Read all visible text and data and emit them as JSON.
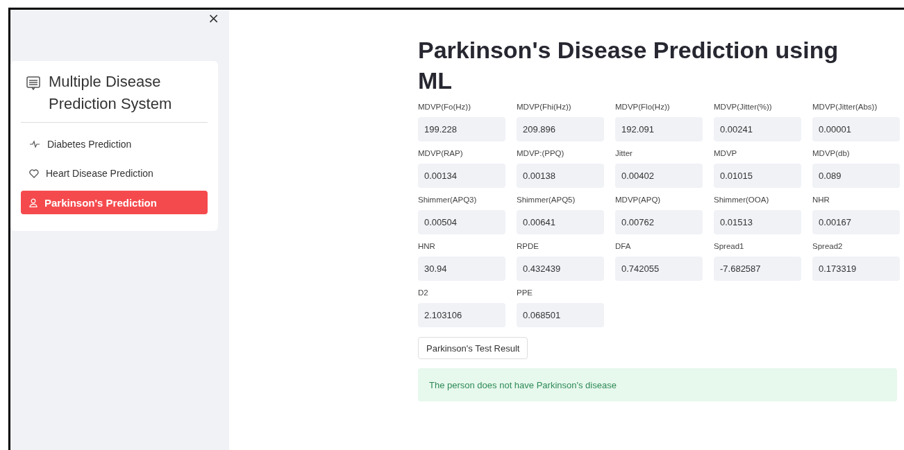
{
  "sidebar": {
    "close": "×",
    "title": "Multiple Disease Prediction System",
    "items": [
      {
        "label": "Diabetes Prediction",
        "kind": "activity",
        "selected": false
      },
      {
        "label": "Heart Disease Prediction",
        "kind": "heart",
        "selected": false
      },
      {
        "label": "Parkinson's Prediction",
        "kind": "person",
        "selected": true
      }
    ]
  },
  "main": {
    "title": "Parkinson's Disease Prediction using ML",
    "fields": [
      {
        "label": "MDVP(Fo(Hz))",
        "value": "199.228"
      },
      {
        "label": "MDVP(Fhi(Hz))",
        "value": "209.896"
      },
      {
        "label": "MDVP(Flo(Hz))",
        "value": "192.091"
      },
      {
        "label": "MDVP(Jitter(%))",
        "value": "0.00241"
      },
      {
        "label": "MDVP(Jitter(Abs))",
        "value": "0.00001"
      },
      {
        "label": "MDVP(RAP)",
        "value": "0.00134"
      },
      {
        "label": "MDVP:(PPQ)",
        "value": "0.00138"
      },
      {
        "label": "Jitter",
        "value": "0.00402"
      },
      {
        "label": "MDVP",
        "value": "0.01015"
      },
      {
        "label": "MDVP(db)",
        "value": "0.089"
      },
      {
        "label": "Shimmer(APQ3)",
        "value": "0.00504"
      },
      {
        "label": "Shimmer(APQ5)",
        "value": "0.00641"
      },
      {
        "label": "MDVP(APQ)",
        "value": "0.00762"
      },
      {
        "label": "Shimmer(OOA)",
        "value": "0.01513"
      },
      {
        "label": "NHR",
        "value": "0.00167"
      },
      {
        "label": "HNR",
        "value": "30.94"
      },
      {
        "label": "RPDE",
        "value": "0.432439"
      },
      {
        "label": "DFA",
        "value": "0.742055"
      },
      {
        "label": "Spread1",
        "value": "-7.682587"
      },
      {
        "label": "Spread2",
        "value": "0.173319"
      },
      {
        "label": "D2",
        "value": "2.103106"
      },
      {
        "label": "PPE",
        "value": "0.068501"
      }
    ],
    "button": "Parkinson's Test Result",
    "result": "The person does not have Parkinson's disease"
  }
}
